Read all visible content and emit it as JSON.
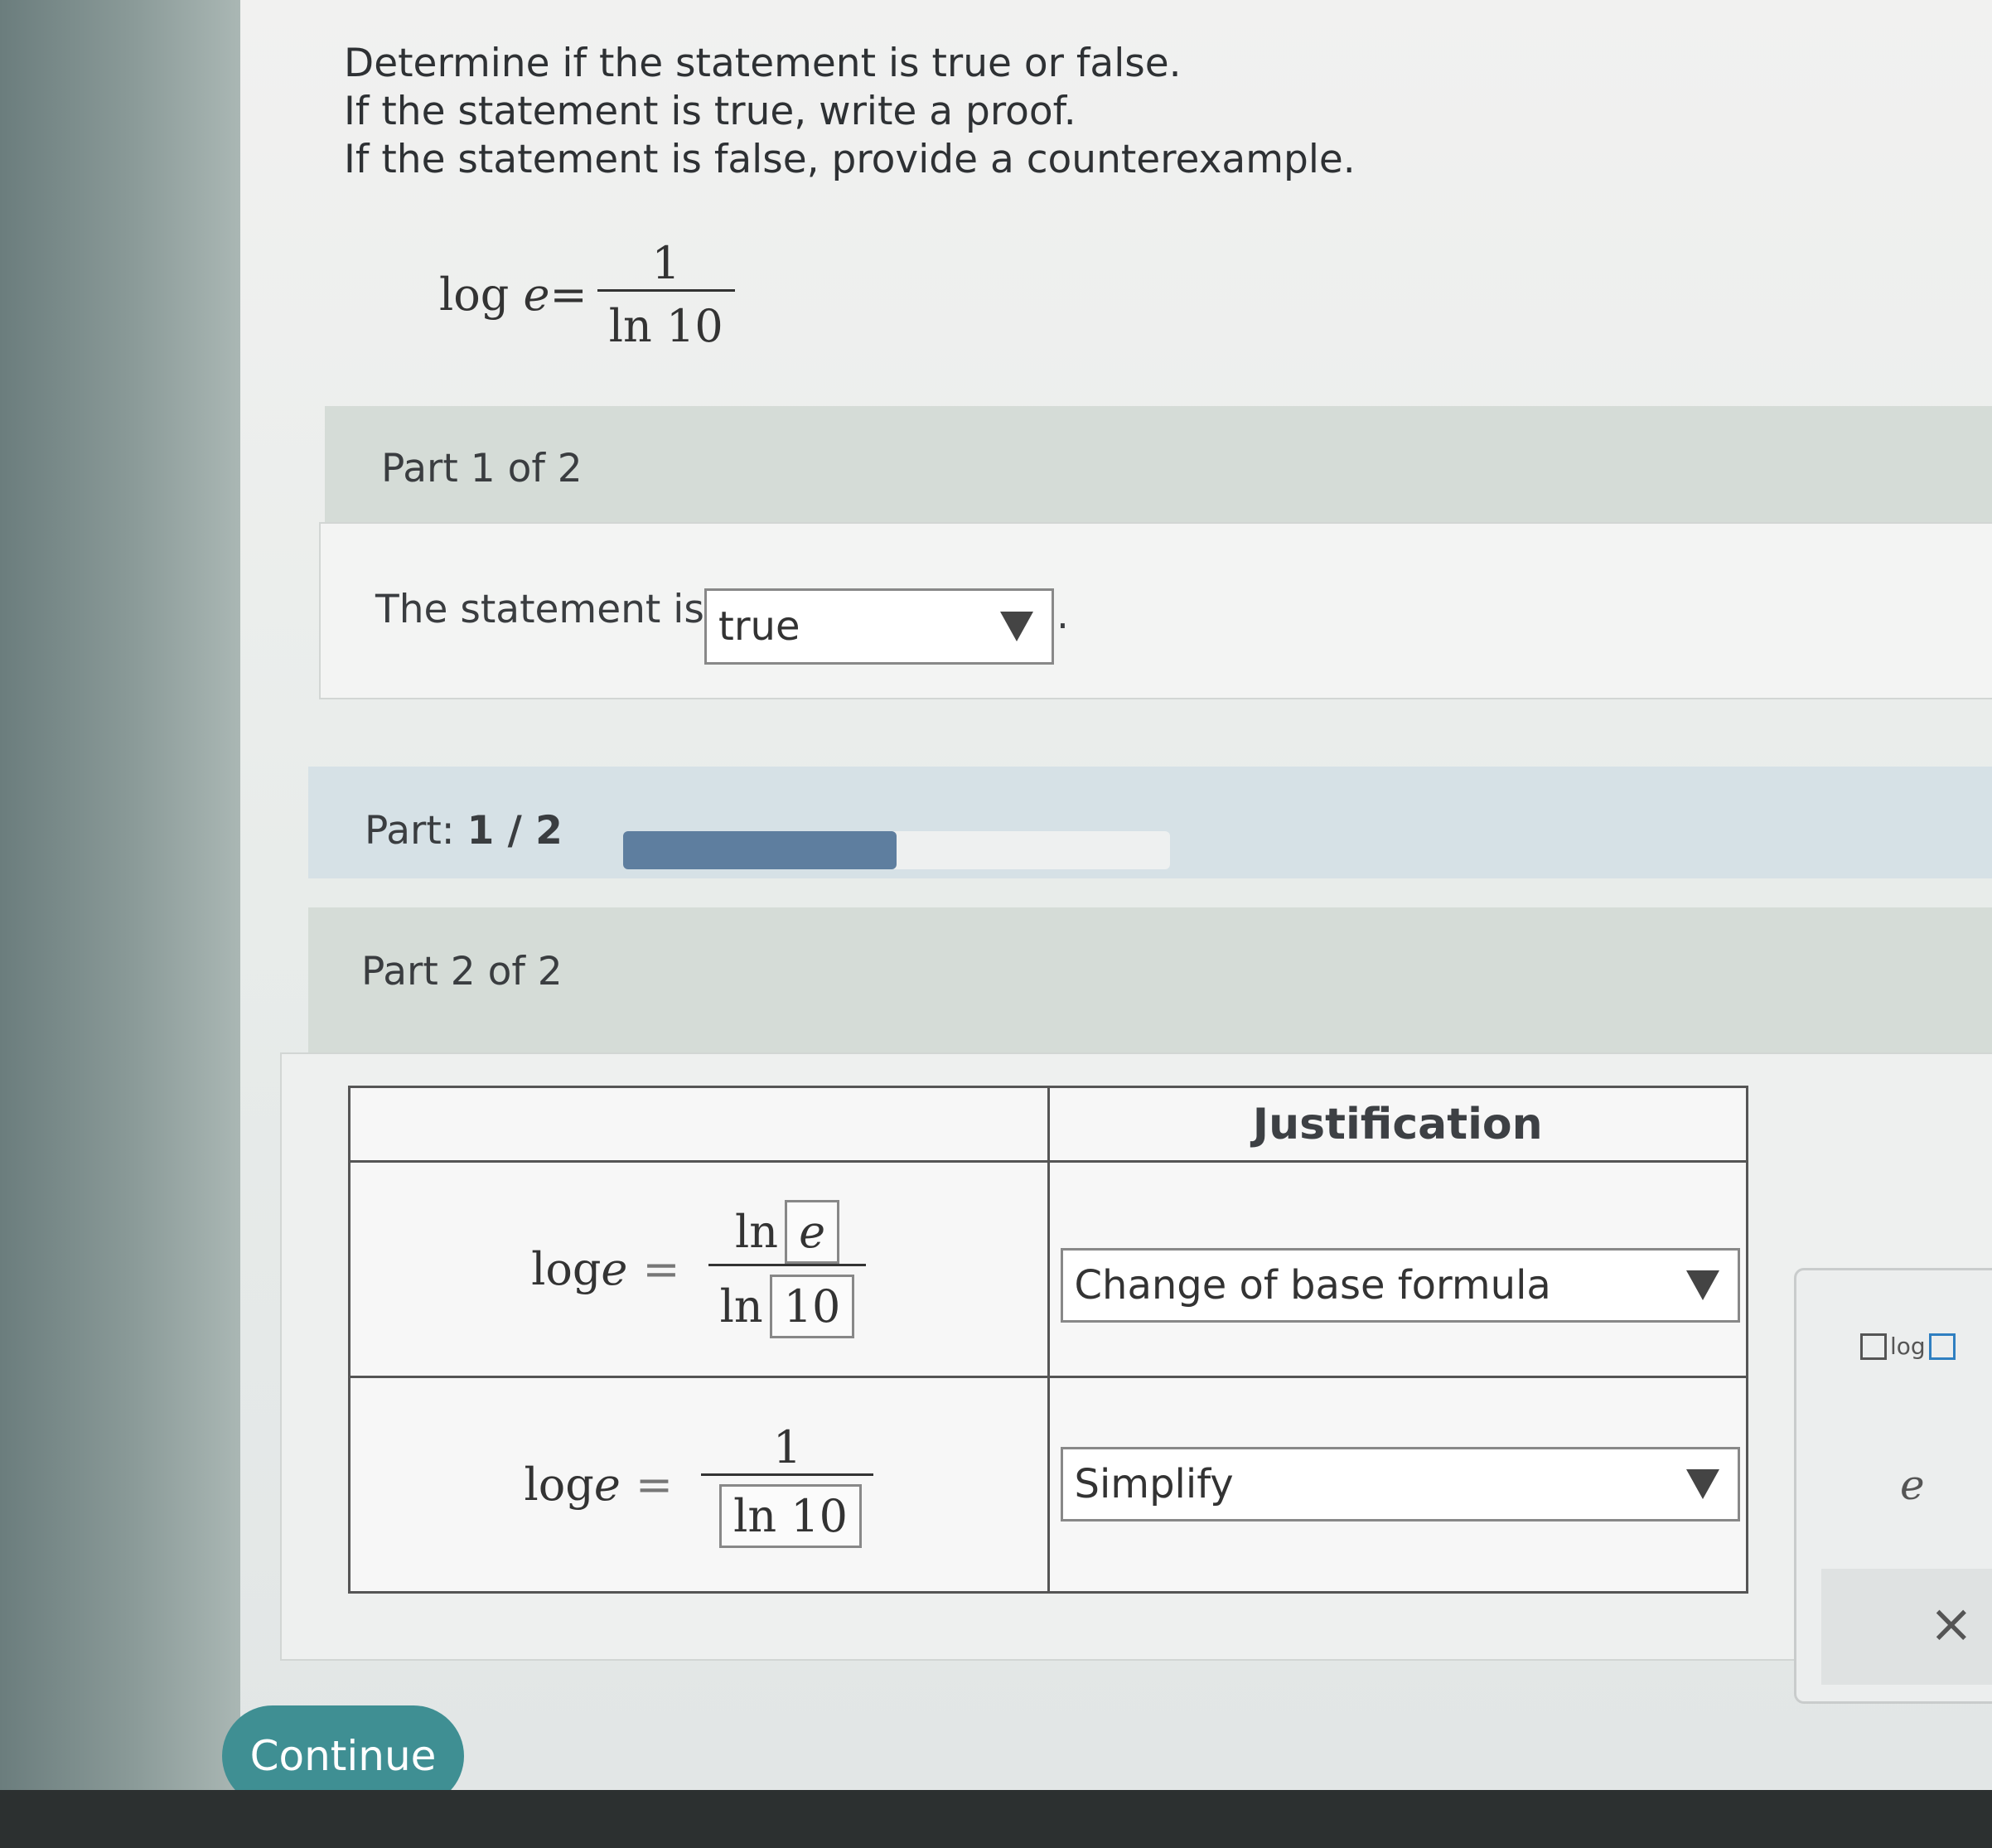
{
  "instructions": {
    "line1": "Determine if the statement is true or false.",
    "line2": "If the statement is true, write a proof.",
    "line3": "If the statement is false, provide a counterexample."
  },
  "statement": {
    "lhs_fn": "log",
    "lhs_var": "e",
    "eq": "=",
    "num": "1",
    "den": "ln 10"
  },
  "part1": {
    "title": "Part 1 of 2",
    "sentence": "The statement is",
    "select_value": "true",
    "period": "."
  },
  "progress": {
    "label": "Part:",
    "value": "1 / 2",
    "fraction": 0.5
  },
  "part2": {
    "title": "Part 2 of 2",
    "table": {
      "header_left": "",
      "header_right": "Justification",
      "rows": [
        {
          "lhs_fn": "log",
          "lhs_var": "e",
          "op": "=",
          "num_fn": "ln",
          "num_box": "e",
          "den_fn": "ln",
          "den_box": "10",
          "justification": "Change of base formula"
        },
        {
          "lhs_fn": "log",
          "lhs_var": "e",
          "op": "=",
          "num": "1",
          "den_box": "ln 10",
          "justification": "Simplify"
        }
      ]
    }
  },
  "keypad": {
    "log_label": "log",
    "e_label": "e",
    "clear_label": "×"
  },
  "continue_label": "Continue"
}
